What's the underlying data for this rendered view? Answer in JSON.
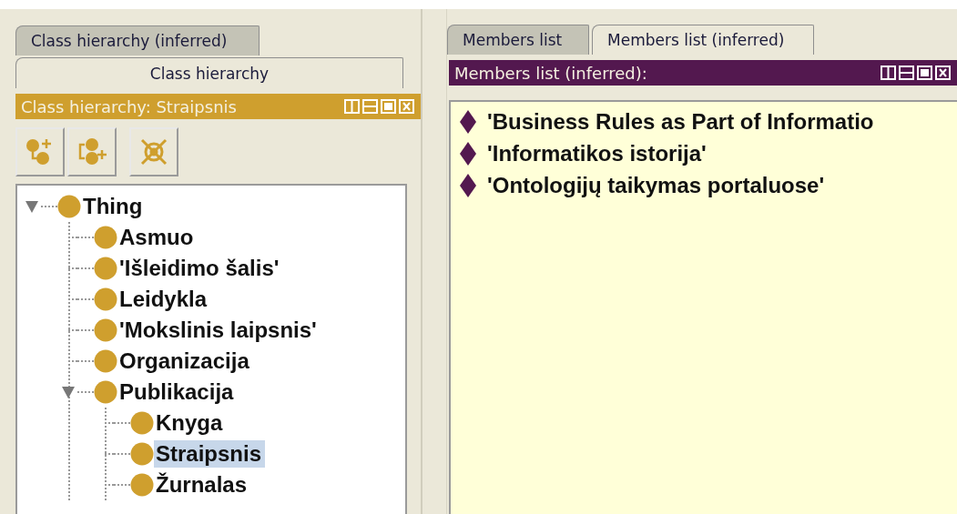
{
  "left_panel": {
    "tabs": [
      {
        "label": "Class hierarchy (inferred)",
        "selected": false
      },
      {
        "label": "Class hierarchy",
        "selected": true
      }
    ],
    "header": {
      "title": "Class hierarchy: Straipsnis"
    },
    "tree": [
      {
        "label": "Thing",
        "expanded": true,
        "selected": false,
        "children": [
          {
            "label": "Asmuo",
            "selected": false
          },
          {
            "label": "'Išleidimo šalis'",
            "selected": false
          },
          {
            "label": "Leidykla",
            "selected": false
          },
          {
            "label": "'Mokslinis laipsnis'",
            "selected": false
          },
          {
            "label": "Organizacija",
            "selected": false
          },
          {
            "label": "Publikacija",
            "expanded": true,
            "selected": false,
            "children": [
              {
                "label": "Knyga",
                "selected": false
              },
              {
                "label": "Straipsnis",
                "selected": true
              },
              {
                "label": "Žurnalas",
                "selected": false
              }
            ]
          }
        ]
      }
    ]
  },
  "right_panel": {
    "tabs": [
      {
        "label": "Members list",
        "selected": false
      },
      {
        "label": "Members list (inferred)",
        "selected": true
      }
    ],
    "header": {
      "title": "Members list (inferred):"
    },
    "members": [
      "'Business Rules as Part of Informatio",
      "'Informatikos istorija'",
      "'Ontologijų taikymas portaluose'"
    ]
  }
}
